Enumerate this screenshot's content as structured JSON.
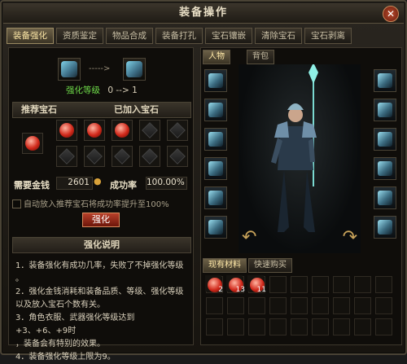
{
  "window": {
    "title": "装备操作",
    "close_label": "✕"
  },
  "tabs": [
    "装备强化",
    "资质鉴定",
    "物品合成",
    "装备打孔",
    "宝石镶嵌",
    "清除宝石",
    "宝石剥离"
  ],
  "left": {
    "strengthen_level_label": "强化等级",
    "strengthen_level_from": "0",
    "strengthen_level_to": "1",
    "recommend_gems_label": "推荐宝石",
    "added_gems_label": "已加入宝石",
    "money_label": "需要金钱",
    "money_value": "2601",
    "success_rate_label": "成功率",
    "success_rate_value": "100.00%",
    "auto_add_text": "自动放入推荐宝石将成功率提升至100%",
    "strengthen_button": "强化",
    "explain_title": "强化说明",
    "explain_lines": [
      "1．装备强化有成功几率，失败了不掉强化等级",
      "。",
      "2．强化金钱消耗和装备品质、等级、强化等级",
      "以及放入宝石个数有关。",
      "3．角色衣服、武器强化等级达到+3、+6、+9时",
      "，装备会有特别的效果。",
      "4．装备强化等级上限为9。"
    ]
  },
  "right": {
    "tab_character": "人物",
    "tab_bag": "背包",
    "materials_tab": "现有材料",
    "quick_buy_tab": "快速购买",
    "materials": [
      {
        "count": "2"
      },
      {
        "count": "13"
      },
      {
        "count": "11"
      }
    ]
  }
}
